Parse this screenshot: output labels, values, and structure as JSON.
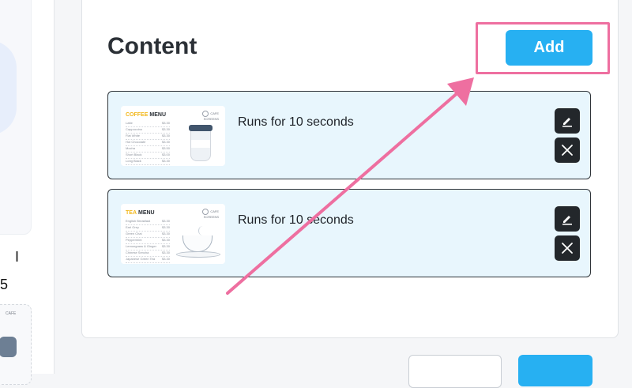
{
  "sidebar": {
    "letter": "I",
    "number": "5"
  },
  "content": {
    "title": "Content",
    "add_label": "Add",
    "items": [
      {
        "runs_text": "Runs for 10 seconds",
        "thumbnail": {
          "heading_accent": "COFFEE",
          "heading_rest": "MENU",
          "brand": "CAFE",
          "brand_sub": "SCREENS",
          "rows": [
            {
              "name": "Latte",
              "price": "$3.30"
            },
            {
              "name": "Cappuccino",
              "price": "$3.30"
            },
            {
              "name": "Flat White",
              "price": "$3.30"
            },
            {
              "name": "Hot Chocolate",
              "price": "$3.30"
            },
            {
              "name": "Mocha",
              "price": "$3.50"
            },
            {
              "name": "Short Black",
              "price": "$3.00"
            },
            {
              "name": "Long Black",
              "price": "$3.30"
            }
          ]
        }
      },
      {
        "runs_text": "Runs for 10 seconds",
        "thumbnail": {
          "heading_accent": "TEA",
          "heading_rest": "MENU",
          "brand": "CAFE",
          "brand_sub": "SCREENS",
          "rows": [
            {
              "name": "English Breakfast",
              "price": "$3.30"
            },
            {
              "name": "Earl Grey",
              "price": "$3.30"
            },
            {
              "name": "Green Chai",
              "price": "$3.30"
            },
            {
              "name": "Peppermint",
              "price": "$3.30"
            },
            {
              "name": "Lemongrass & Ginger",
              "price": "$3.30"
            },
            {
              "name": "Chinese Sencha",
              "price": "$3.30"
            },
            {
              "name": "Japanese Green Tea",
              "price": "$3.30"
            }
          ]
        }
      }
    ]
  },
  "colors": {
    "accent": "#27b0f2",
    "highlight": "#ee6fa0",
    "item_bg": "#e8f6fd"
  },
  "icons": [
    "edit-icon",
    "close-icon",
    "annotation-arrow"
  ]
}
